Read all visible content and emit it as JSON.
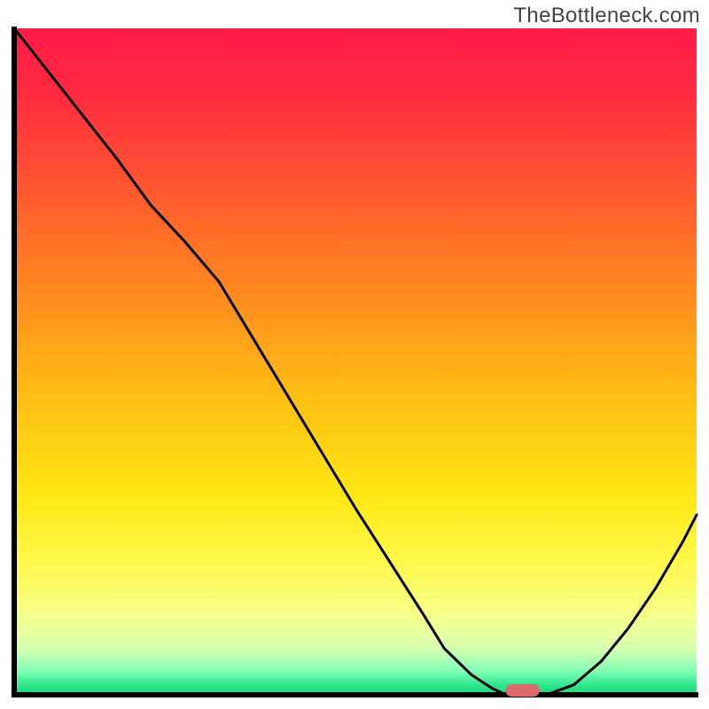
{
  "watermark": "TheBottleneck.com",
  "chart_data": {
    "type": "line",
    "title": "",
    "xlabel": "",
    "ylabel": "",
    "xlim": [
      0,
      100
    ],
    "ylim": [
      0,
      100
    ],
    "x": [
      0,
      5,
      10,
      15,
      20,
      25,
      30,
      35,
      40,
      45,
      50,
      55,
      60,
      63,
      67,
      70,
      72,
      75,
      78,
      82,
      86,
      90,
      94,
      98,
      100
    ],
    "y": [
      100,
      93.5,
      87,
      80.5,
      73.5,
      68,
      62,
      53.5,
      45,
      36.5,
      28,
      20,
      12,
      7,
      3,
      1,
      0,
      0,
      0,
      1.5,
      5,
      10,
      16,
      23,
      27
    ],
    "series_name": "bottleneck-curve",
    "marker": {
      "x_start": 72,
      "x_end": 77,
      "y": 0
    },
    "gradient_stops": [
      {
        "offset": 0.0,
        "color": "#ff1a49"
      },
      {
        "offset": 0.1,
        "color": "#ff2b40"
      },
      {
        "offset": 0.25,
        "color": "#ff5a2e"
      },
      {
        "offset": 0.4,
        "color": "#ff8b1f"
      },
      {
        "offset": 0.55,
        "color": "#ffbd14"
      },
      {
        "offset": 0.7,
        "color": "#ffe714"
      },
      {
        "offset": 0.8,
        "color": "#fff94a"
      },
      {
        "offset": 0.88,
        "color": "#f6ff8a"
      },
      {
        "offset": 0.93,
        "color": "#d9ffb0"
      },
      {
        "offset": 0.965,
        "color": "#7fffb5"
      },
      {
        "offset": 0.985,
        "color": "#2fe68f"
      },
      {
        "offset": 1.0,
        "color": "#18d576"
      }
    ],
    "axis_color": "#000000",
    "curve_color": "#000000",
    "marker_fill": "#de6b6b",
    "background": "#ffffff"
  }
}
